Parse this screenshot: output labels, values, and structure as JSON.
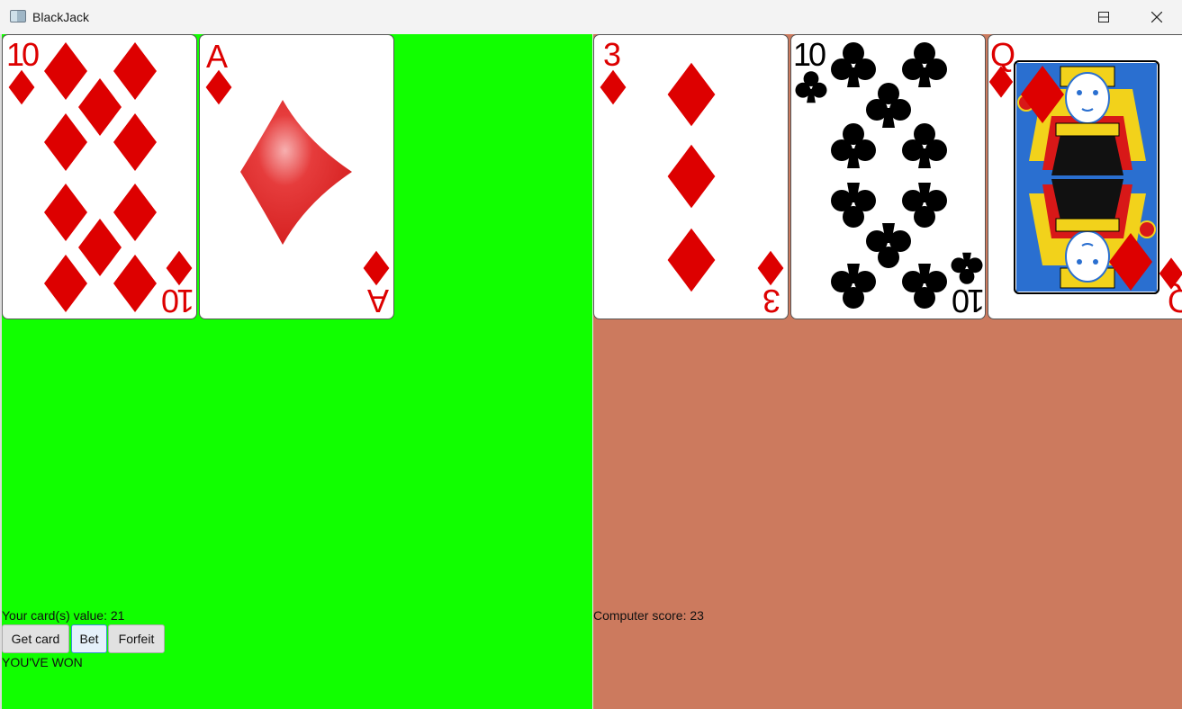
{
  "window": {
    "title": "BlackJack"
  },
  "player": {
    "cards": [
      {
        "rank": "10",
        "suit": "diamonds"
      },
      {
        "rank": "A",
        "suit": "diamonds"
      }
    ],
    "value_label": "Your card(s) value: 21",
    "buttons": {
      "get_card": "Get card",
      "bet": "Bet",
      "forfeit": "Forfeit"
    },
    "result": "YOU'VE WON"
  },
  "computer": {
    "cards": [
      {
        "rank": "3",
        "suit": "diamonds"
      },
      {
        "rank": "10",
        "suit": "clubs"
      },
      {
        "rank": "Q",
        "suit": "diamonds"
      }
    ],
    "score_label": "Computer score: 23"
  },
  "colors": {
    "player_table": "#11ff00",
    "computer_table": "#cc7a5e",
    "red_suit": "#dd0000",
    "black_suit": "#000000"
  }
}
